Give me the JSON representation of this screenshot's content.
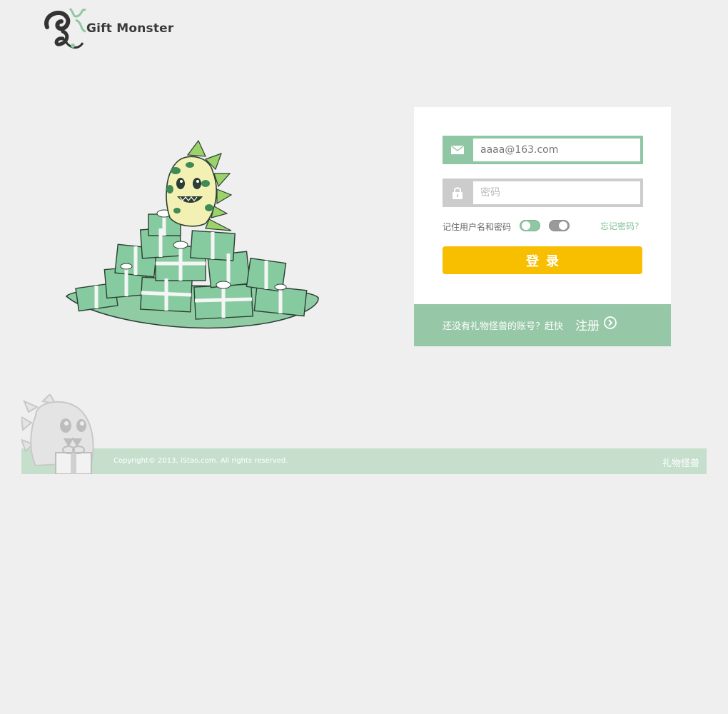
{
  "logo": {
    "text": "Gift Monster",
    "icon": "monster-logo-icon"
  },
  "login": {
    "email_value": "aaaa@163.com",
    "email_icon": "envelope-icon",
    "password_placeholder": "密码",
    "password_icon": "lock-icon",
    "remember_label": "记住用户名和密码",
    "remember_toggle_on": true,
    "second_toggle_on": false,
    "forgot_label": "忘记密码？",
    "submit_label": "登录"
  },
  "register": {
    "prompt": "还没有礼物怪兽的账号？赶快",
    "link_label": "注册",
    "link_icon": "chevron-right-circle-icon"
  },
  "footer": {
    "copyright": "Copyright© 2013, iStao.com. All rights reserved.",
    "brand": "礼物怪兽"
  },
  "colors": {
    "accent_green": "#8fc7a4",
    "button_yellow": "#f7bf00",
    "footer_green": "#c6dfcd",
    "background": "#efefef"
  }
}
